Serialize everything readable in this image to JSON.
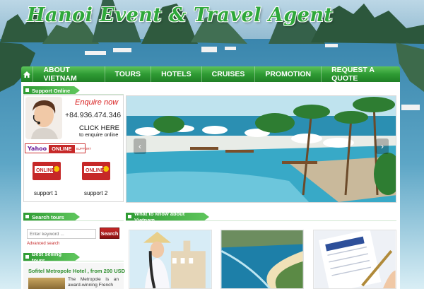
{
  "banner": {
    "title": "Hanoi Event & Travel Agent"
  },
  "nav": {
    "home_icon": "home-icon",
    "items": [
      "About Vietnam",
      "Tours",
      "Hotels",
      "Cruises",
      "Promotion",
      "Request a Quote"
    ]
  },
  "support": {
    "heading": "Support Online",
    "enquire": "Enquire now",
    "phone": "+84.936.474.346",
    "click_here": "CLICK HERE",
    "to_enquire": "to enquire online",
    "yahoo": "Yahoo",
    "online": "ONLINE",
    "support_small": "SUPPORT",
    "badge_text": "ONLINE",
    "support1": "support 1",
    "support2": "support 2"
  },
  "search_tours": {
    "heading": "Search tours",
    "placeholder": "Enter keyword ...",
    "button": "Search",
    "advanced": "Advanced search"
  },
  "best_selling": {
    "heading": "Best selling tours",
    "hotel_title": "Sofitel Metropole Hotel , from 200 USD",
    "hotel_desc": "The Metropole is an award-winning French"
  },
  "know_vietnam": {
    "heading": "What to know about Vietnam"
  },
  "colors": {
    "brand_green": "#2f9b34",
    "accent_red": "#c62828",
    "text_dark": "#111111"
  }
}
